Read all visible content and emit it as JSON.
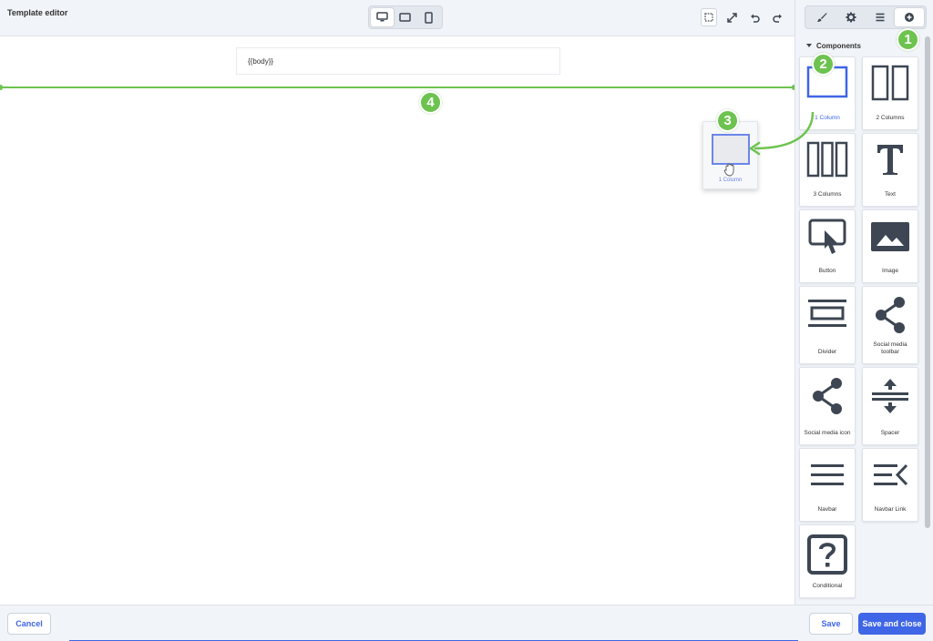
{
  "app": {
    "title": "Template editor"
  },
  "canvas": {
    "body_placeholder": "{{body}}"
  },
  "steps": [
    "1",
    "2",
    "3",
    "4"
  ],
  "ghost": {
    "label": "1 Column"
  },
  "sidebar": {
    "section_title": "Components",
    "components": [
      {
        "label": "1 Column",
        "icon": "one-column-icon"
      },
      {
        "label": "2 Columns",
        "icon": "two-columns-icon"
      },
      {
        "label": "3 Columns",
        "icon": "three-columns-icon"
      },
      {
        "label": "Text",
        "icon": "text-icon"
      },
      {
        "label": "Button",
        "icon": "button-icon"
      },
      {
        "label": "Image",
        "icon": "image-icon"
      },
      {
        "label": "Divider",
        "icon": "divider-icon"
      },
      {
        "label": "Social media toolbar",
        "icon": "share-icon"
      },
      {
        "label": "Social media icon",
        "icon": "share-icon"
      },
      {
        "label": "Spacer",
        "icon": "spacer-icon"
      },
      {
        "label": "Navbar",
        "icon": "navbar-icon"
      },
      {
        "label": "Navbar Link",
        "icon": "navbar-link-icon"
      },
      {
        "label": "Conditional",
        "icon": "question-icon"
      }
    ]
  },
  "footer": {
    "cancel": "Cancel",
    "save": "Save",
    "save_close": "Save and close"
  },
  "colors": {
    "accent": "#3f66e6",
    "step": "#6dc34f",
    "icon": "#3d4652"
  }
}
